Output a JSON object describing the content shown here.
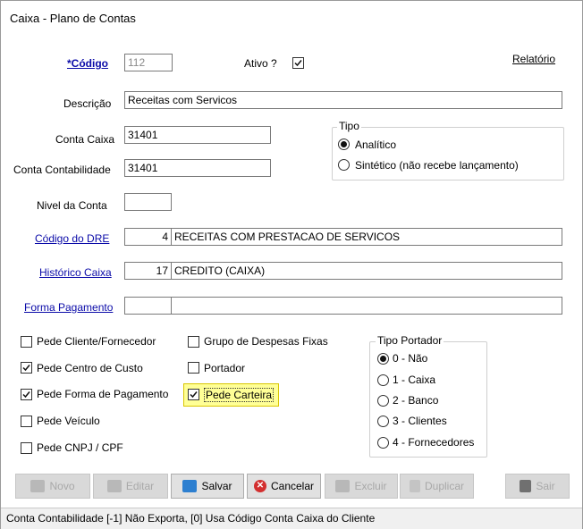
{
  "window": {
    "title": "Caixa - Plano de Contas"
  },
  "form": {
    "codigo_label": "*Código",
    "codigo_value": "112",
    "ativo_label": "Ativo ?",
    "ativo_checked": true,
    "relatorio_link": "Relatório",
    "descricao_label": "Descrição",
    "descricao_value": "Receitas com Servicos",
    "conta_caixa_label": "Conta Caixa",
    "conta_caixa_value": "31401",
    "conta_contabilidade_label": "Conta Contabilidade",
    "conta_contabilidade_value": "31401",
    "nivel_label": "Nivel da Conta",
    "nivel_value": "",
    "dre_label": "Código do DRE",
    "dre_code": "4",
    "dre_desc": "RECEITAS COM PRESTACAO DE SERVICOS",
    "historico_label": "Histórico Caixa",
    "historico_code": "17",
    "historico_desc": "CREDITO (CAIXA)",
    "forma_label": "Forma Pagamento",
    "forma_code": "",
    "forma_desc": ""
  },
  "tipo": {
    "title": "Tipo",
    "options": [
      "Analítico",
      "Sintético (não recebe lançamento)"
    ],
    "selected": 0
  },
  "checkboxes": {
    "pede_cliente": {
      "label": "Pede Cliente/Fornecedor",
      "checked": false
    },
    "pede_centro": {
      "label": "Pede Centro de Custo",
      "checked": true
    },
    "pede_forma": {
      "label": "Pede Forma de Pagamento",
      "checked": true
    },
    "pede_veiculo": {
      "label": "Pede Veículo",
      "checked": false
    },
    "pede_cnpj": {
      "label": "Pede CNPJ / CPF",
      "checked": false
    },
    "grupo_despesas": {
      "label": "Grupo de Despesas Fixas",
      "checked": false
    },
    "portador": {
      "label": "Portador",
      "checked": false
    },
    "pede_carteira": {
      "label": "Pede Carteira",
      "checked": true
    }
  },
  "tipo_portador": {
    "title": "Tipo Portador",
    "options": [
      "0 - Não",
      "1 - Caixa",
      "2 - Banco",
      "3 - Clientes",
      "4 - Fornecedores"
    ],
    "selected": 0
  },
  "buttons": {
    "novo": "Novo",
    "editar": "Editar",
    "salvar": "Salvar",
    "cancelar": "Cancelar",
    "excluir": "Excluir",
    "duplicar": "Duplicar",
    "sair": "Sair"
  },
  "status": {
    "text": "Conta Contabilidade [-1] Não Exporta, [0] Usa Código Conta Caixa do Cliente"
  },
  "colors": {
    "link": "#0a0aa8",
    "highlight": "#ffff96",
    "cancel_icon": "#d32f2f",
    "save_icon": "#2d7fd0"
  }
}
